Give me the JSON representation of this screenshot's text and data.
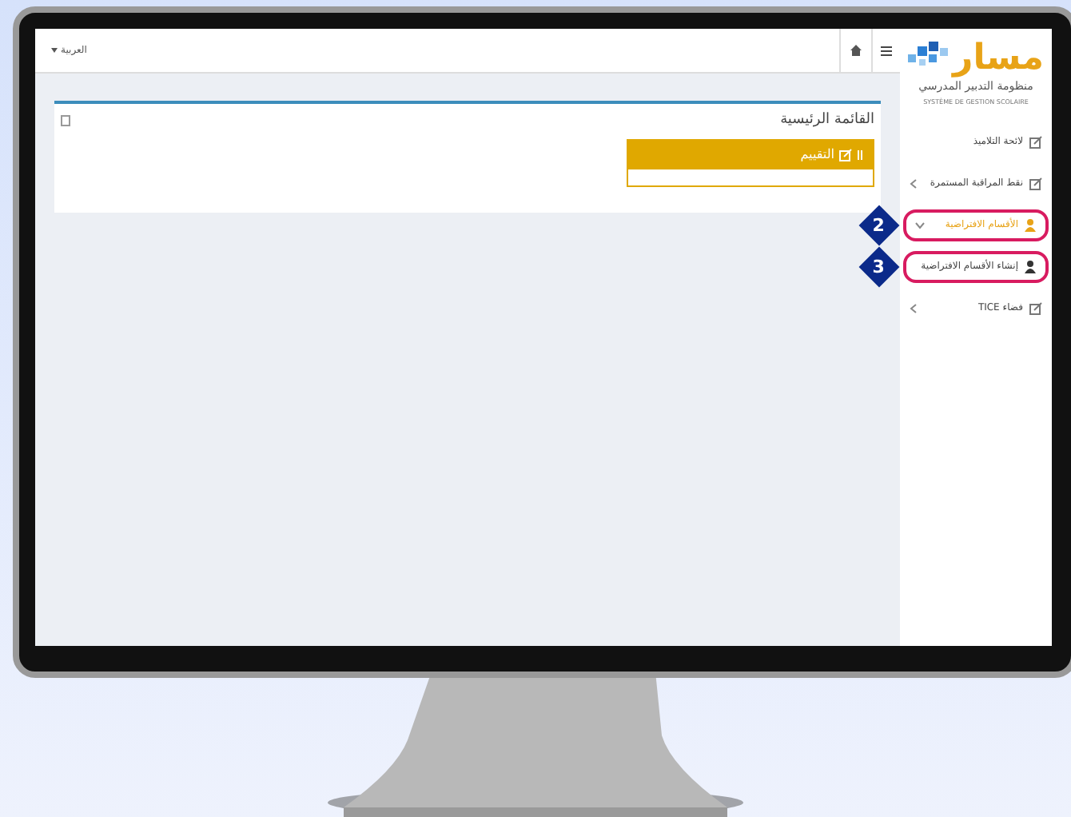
{
  "topbar": {
    "language": "العربية"
  },
  "logo": {
    "name": "مسار",
    "subtitle": "منظومة التدبير المدرسي",
    "tagline": "SYSTÈME DE GESTION SCOLAIRE"
  },
  "sidebar": {
    "items": [
      {
        "label": "لائحة التلاميذ",
        "kind": "edit",
        "selected": false
      },
      {
        "label": "نقط المراقبة المستمرة",
        "kind": "edit",
        "selected": false,
        "expanded": false
      },
      {
        "label": "الأقسام الافتراضية",
        "kind": "user",
        "selected": true,
        "expanded": true,
        "callout": "2",
        "children": [
          {
            "label": "إنشاء الأقسام الافتراضية",
            "kind": "user",
            "selected": false,
            "callout": "3"
          }
        ]
      },
      {
        "label": "فضاء TICE",
        "kind": "edit",
        "selected": false,
        "expanded": false
      }
    ]
  },
  "main": {
    "title": "القائمة الرئيسية",
    "panel": {
      "title": "التقييم"
    }
  }
}
